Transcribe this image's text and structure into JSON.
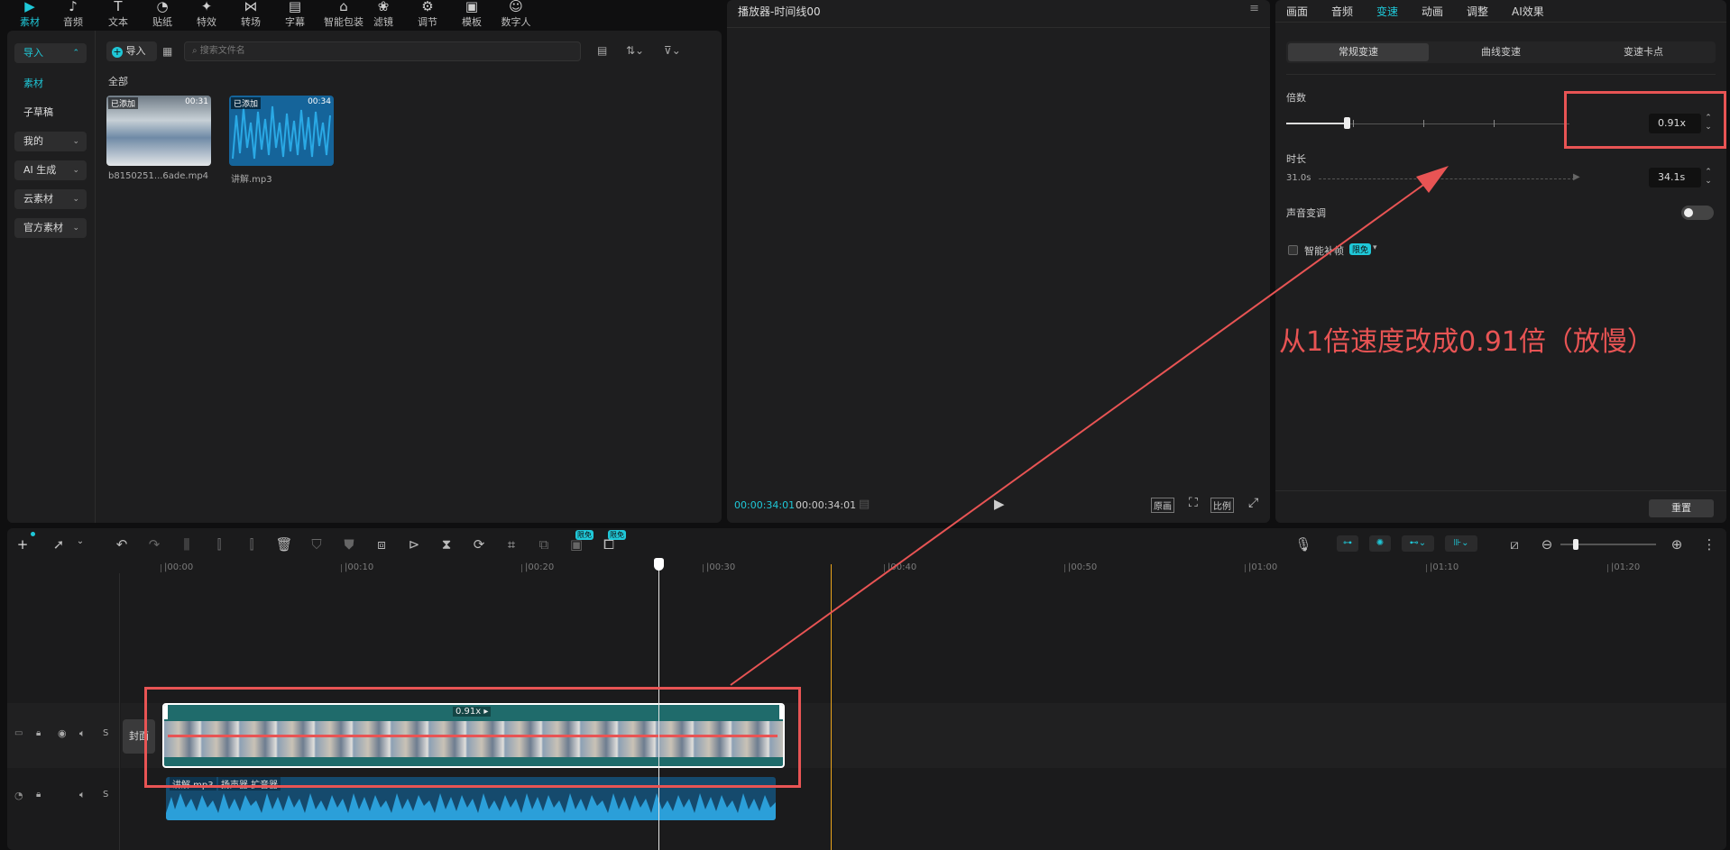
{
  "top_tools": [
    {
      "label": "素材",
      "icon": "media-icon",
      "active": true
    },
    {
      "label": "音频",
      "icon": "music-note-icon"
    },
    {
      "label": "文本",
      "icon": "text-icon"
    },
    {
      "label": "贴纸",
      "icon": "sticker-icon"
    },
    {
      "label": "特效",
      "icon": "effects-icon"
    },
    {
      "label": "转场",
      "icon": "transition-icon"
    },
    {
      "label": "字幕",
      "icon": "subtitle-icon"
    },
    {
      "label": "智能包装",
      "icon": "smart-package-icon"
    },
    {
      "label": "滤镜",
      "icon": "filter-icon"
    },
    {
      "label": "调节",
      "icon": "adjust-icon"
    },
    {
      "label": "模板",
      "icon": "template-icon"
    },
    {
      "label": "数字人",
      "icon": "digital-human-icon"
    }
  ],
  "sidebar": {
    "items": [
      {
        "label": "导入",
        "active": true
      },
      {
        "label": "素材",
        "sub": true
      },
      {
        "label": "子草稿",
        "sub": true
      },
      {
        "label": "我的"
      },
      {
        "label": "AI 生成"
      },
      {
        "label": "云素材"
      },
      {
        "label": "官方素材"
      }
    ]
  },
  "media": {
    "import_label": "导入",
    "search_placeholder": "搜索文件名",
    "section": "全部",
    "items": [
      {
        "name": "b8150251...6ade.mp4",
        "badge": "已添加",
        "duration": "00:31"
      },
      {
        "name": "讲解.mp3",
        "badge": "已添加",
        "duration": "00:34"
      }
    ]
  },
  "player": {
    "title": "播放器-时间线00",
    "current": "00:00:34:01",
    "total": "00:00:34:01",
    "btn_original": "原画",
    "btn_ratio": "比例"
  },
  "right_panel": {
    "tabs": [
      "画面",
      "音频",
      "变速",
      "动画",
      "调整",
      "AI效果"
    ],
    "active_tab": "变速",
    "subtabs": [
      "常规变速",
      "曲线变速",
      "变速卡点"
    ],
    "speed_label": "倍数",
    "speed_value": "0.91x",
    "speed_fraction": 0.14,
    "duration_label": "时长",
    "duration_from": "31.0s",
    "duration_value": "34.1s",
    "pitch_label": "声音变调",
    "smart_label": "智能补帧",
    "smart_badge": "限免",
    "reset": "重置"
  },
  "annotation": {
    "text": "从1倍速度改成0.91倍（放慢）",
    "color": "#e85454"
  },
  "toolbar": {
    "badge1": "限免",
    "badge2": "限免"
  },
  "timeline": {
    "ticks": [
      "|00:00",
      "|00:10",
      "|00:20",
      "|00:30",
      "|00:40",
      "|00:50",
      "|01:00",
      "|01:10",
      "|01:20"
    ],
    "cover_label": "封面",
    "clip_speed": "0.91x",
    "audio_name": "讲解.mp3",
    "audio_effect": "扬声器 扩音器"
  },
  "colors": {
    "accent": "#1fc8d8",
    "annotation": "#e85454",
    "clip": "#1f6b6b",
    "audio": "#1a6c9a"
  }
}
